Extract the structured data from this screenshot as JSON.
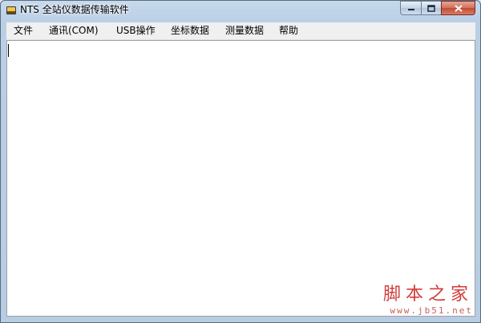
{
  "window": {
    "title": "NTS 全站仪数据传输软件"
  },
  "menu": {
    "items": [
      {
        "key": "file",
        "label": "文件"
      },
      {
        "key": "comm",
        "label": "通讯(COM)"
      },
      {
        "key": "usb",
        "label": "USB操作"
      },
      {
        "key": "coord",
        "label": "坐标数据"
      },
      {
        "key": "measure",
        "label": "测量数据"
      },
      {
        "key": "help",
        "label": "帮助"
      }
    ]
  },
  "editor": {
    "value": ""
  },
  "watermark": {
    "brand_cn": "脚本之家",
    "brand_url": "www.jb51.net"
  },
  "colors": {
    "accent": "#c44a33",
    "watermark": "#d23c3c"
  }
}
